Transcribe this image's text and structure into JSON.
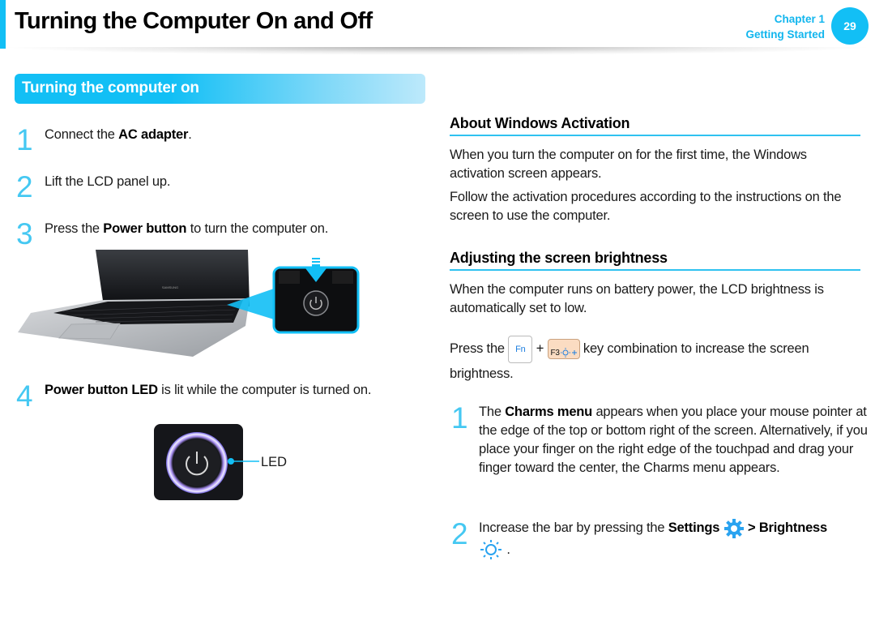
{
  "header": {
    "title": "Turning the Computer On and Off",
    "chapter": "Chapter 1",
    "chapter_name": "Getting Started",
    "page_number": "29",
    "accent_color": "#12bff5"
  },
  "left": {
    "section_title": "Turning the computer on",
    "steps": [
      {
        "num": "1",
        "pre": "Connect the ",
        "bold": "AC adapter",
        "post": "."
      },
      {
        "num": "2",
        "pre": "Lift the LCD panel up.",
        "bold": "",
        "post": ""
      },
      {
        "num": "3",
        "pre": "Press the ",
        "bold": "Power button",
        "post": " to turn the computer on."
      },
      {
        "num": "4",
        "pre": "",
        "bold": "Power button LED",
        "post": " is lit while the computer is turned on."
      }
    ],
    "laptop_brand_text": "SAMSUNG",
    "led_label": "LED"
  },
  "right": {
    "activation": {
      "heading": "About Windows Activation",
      "p1": "When you turn the computer on for the first time, the Windows activation screen appears.",
      "p2": "Follow the activation procedures according to the instructions on the screen to use the computer."
    },
    "brightness": {
      "heading": "Adjusting the screen brightness",
      "p1": "When the computer runs on battery power, the LCD brightness is automatically set to low.",
      "press_pre": "Press the",
      "key_fn": "Fn",
      "plus": "+",
      "key_f3": "F3",
      "press_post": "key combination to increase the screen",
      "press_post2": "brightness.",
      "steps": [
        {
          "num": "1",
          "pre": "The ",
          "bold": "Charms menu",
          "post": " appears when you place your mouse pointer at the edge of the top or bottom right of the screen. Alternatively, if you place your finger on the right edge of the touchpad and drag your finger toward the center, the Charms menu appears."
        },
        {
          "num": "2",
          "pre": "Increase the bar by pressing the ",
          "bold": "Settings",
          "sep": " > ",
          "bold2": "Brightness",
          "post": "."
        }
      ]
    }
  }
}
